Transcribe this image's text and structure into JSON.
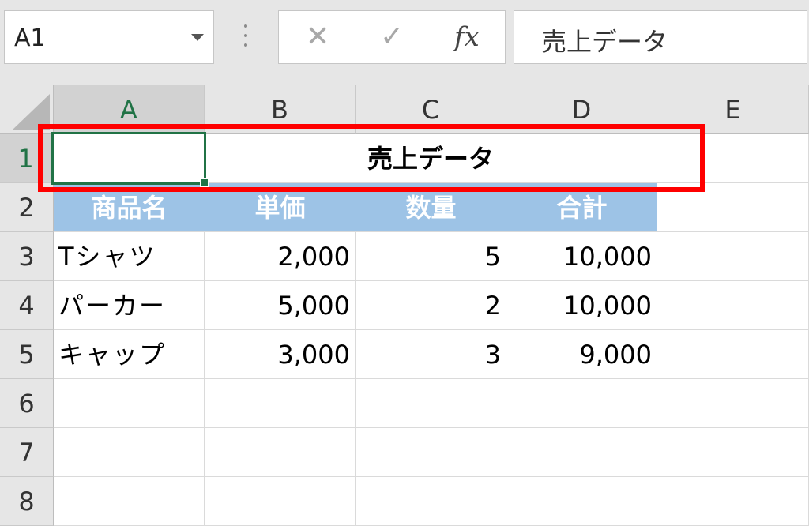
{
  "namebox": {
    "value": "A1"
  },
  "formula_bar": {
    "cancel_icon": "✕",
    "enter_icon": "✓",
    "fx_label": "fx",
    "content": "売上データ"
  },
  "columns": [
    "A",
    "B",
    "C",
    "D",
    "E"
  ],
  "rows": [
    "1",
    "2",
    "3",
    "4",
    "5",
    "6",
    "7",
    "8"
  ],
  "sheet": {
    "title": "売上データ",
    "headers": [
      "商品名",
      "単価",
      "数量",
      "合計"
    ],
    "data": [
      [
        "Tシャツ",
        "2,000",
        "5",
        "10,000"
      ],
      [
        "パーカー",
        "5,000",
        "2",
        "10,000"
      ],
      [
        "キャップ",
        "3,000",
        "3",
        "9,000"
      ]
    ]
  },
  "colors": {
    "accent": "#217346",
    "header_fill": "#9dc3e6",
    "highlight": "#ff0000"
  }
}
